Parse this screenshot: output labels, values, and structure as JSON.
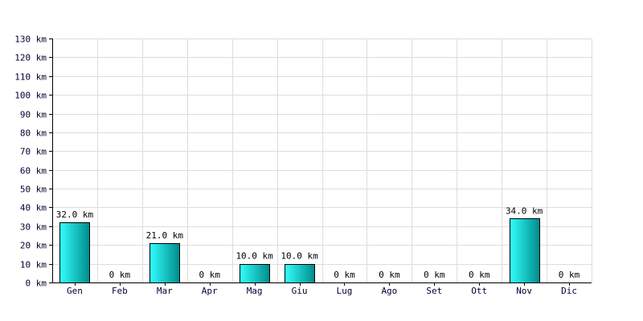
{
  "chart_data": {
    "type": "bar",
    "title": "",
    "xlabel": "",
    "ylabel": "",
    "categories": [
      "Gen",
      "Feb",
      "Mar",
      "Apr",
      "Mag",
      "Giu",
      "Lug",
      "Ago",
      "Set",
      "Ott",
      "Nov",
      "Dic"
    ],
    "values": [
      32.0,
      0,
      21.0,
      0,
      10.0,
      10.0,
      0,
      0,
      0,
      0,
      34.0,
      0
    ],
    "data_labels": [
      "32.0 km",
      "0 km",
      "21.0 km",
      "0 km",
      "10.0 km",
      "10.0 km",
      "0 km",
      "0 km",
      "0 km",
      "0 km",
      "34.0 km",
      "0 km"
    ],
    "unit": "km",
    "ylim": [
      0,
      130
    ],
    "yticks": [
      0,
      10,
      20,
      30,
      40,
      50,
      60,
      70,
      80,
      90,
      100,
      110,
      120,
      130
    ],
    "ytick_labels": [
      "0 km",
      "10 km",
      "20 km",
      "30 km",
      "40 km",
      "50 km",
      "60 km",
      "70 km",
      "80 km",
      "90 km",
      "100 km",
      "110 km",
      "120 km",
      "130 km"
    ],
    "grid": true,
    "legend": "none",
    "colors": {
      "bar_light": "#33ffff",
      "bar_dark": "#008b8b",
      "bar_stroke": "#000000",
      "grid": "#dddddd",
      "axis": "#000000"
    }
  }
}
